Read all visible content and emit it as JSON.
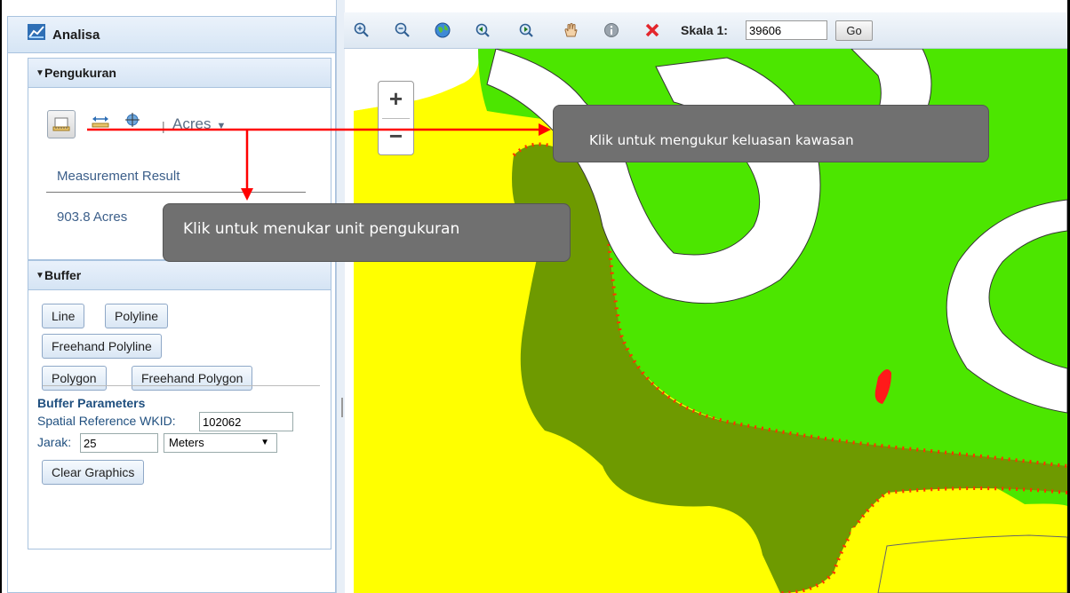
{
  "sidebar": {
    "title": "Analisa",
    "measurement": {
      "header": "Pengukuran",
      "unit": "Acres",
      "result_label": "Measurement Result",
      "result_value": "903.8 Acres"
    },
    "buffer": {
      "header": "Buffer",
      "buttons": {
        "line": "Line",
        "polyline": "Polyline",
        "freehand_polyline": "Freehand Polyline",
        "polygon": "Polygon",
        "freehand_polygon": "Freehand Polygon"
      },
      "params_title": "Buffer Parameters",
      "wkid_label": "Spatial Reference WKID:",
      "wkid_value": "102062",
      "distance_label": "Jarak:",
      "distance_value": "25",
      "distance_unit": "Meters",
      "clear_label": "Clear Graphics"
    }
  },
  "toolbar": {
    "icons": [
      "zoom-in-icon",
      "zoom-out-icon",
      "full-extent-globe-icon",
      "previous-extent-icon",
      "next-extent-icon",
      "pan-hand-icon",
      "info-icon",
      "clear-x-icon"
    ],
    "scale_label": "Skala 1:",
    "scale_value": "39606",
    "go_label": "Go"
  },
  "map": {
    "zoom_in": "+",
    "zoom_out": "−"
  },
  "callouts": {
    "measure": "Klik untuk mengukur keluasan kawasan",
    "unit": "Klik untuk menukar unit pengukuran"
  },
  "colors": {
    "map_yellow": "#ffff00",
    "map_green": "#4ce600",
    "map_dark_green": "#6e9a00",
    "river_white": "#ffffff",
    "arrow_red": "#ff0000",
    "measure_red_dots": "#ff3300"
  }
}
